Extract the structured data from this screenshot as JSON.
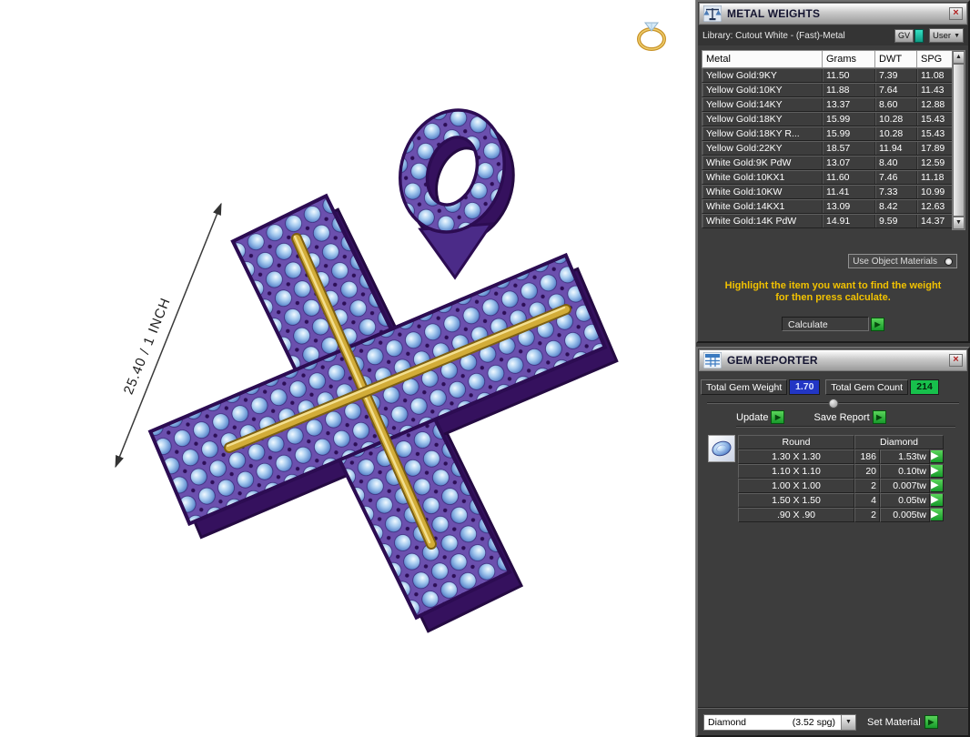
{
  "icons": {
    "close": "×",
    "dropdown": "▼",
    "scroll_up": "▲",
    "scroll_down": "▼",
    "play": "▶"
  },
  "viewport": {
    "dimension_label": "25.40 / 1 INCH"
  },
  "metal_weights": {
    "title": "METAL WEIGHTS",
    "library": "Library: Cutout White - (Fast)-Metal",
    "gv_label": "GV",
    "user_label": "User",
    "columns": [
      "Metal",
      "Grams",
      "DWT",
      "SPG"
    ],
    "rows": [
      {
        "metal": "Yellow Gold:9KY",
        "grams": "11.50",
        "dwt": "7.39",
        "spg": "11.08"
      },
      {
        "metal": "Yellow Gold:10KY",
        "grams": "11.88",
        "dwt": "7.64",
        "spg": "11.43"
      },
      {
        "metal": "Yellow Gold:14KY",
        "grams": "13.37",
        "dwt": "8.60",
        "spg": "12.88"
      },
      {
        "metal": "Yellow Gold:18KY",
        "grams": "15.99",
        "dwt": "10.28",
        "spg": "15.43"
      },
      {
        "metal": "Yellow Gold:18KY R...",
        "grams": "15.99",
        "dwt": "10.28",
        "spg": "15.43"
      },
      {
        "metal": "Yellow Gold:22KY",
        "grams": "18.57",
        "dwt": "11.94",
        "spg": "17.89"
      },
      {
        "metal": "White Gold:9K PdW",
        "grams": "13.07",
        "dwt": "8.40",
        "spg": "12.59"
      },
      {
        "metal": "White Gold:10KX1",
        "grams": "11.60",
        "dwt": "7.46",
        "spg": "11.18"
      },
      {
        "metal": "White Gold:10KW",
        "grams": "11.41",
        "dwt": "7.33",
        "spg": "10.99"
      },
      {
        "metal": "White Gold:14KX1",
        "grams": "13.09",
        "dwt": "8.42",
        "spg": "12.63"
      },
      {
        "metal": "White Gold:14K PdW",
        "grams": "14.91",
        "dwt": "9.59",
        "spg": "14.37"
      }
    ],
    "use_object_materials": "Use Object Materials",
    "instruction_line1": "Highlight the item you want to find the weight",
    "instruction_line2": "for then press calculate.",
    "calculate_label": "Calculate"
  },
  "gem_reporter": {
    "title": "GEM REPORTER",
    "total_weight_label": "Total Gem Weight",
    "total_weight_value": "1.70",
    "total_count_label": "Total Gem Count",
    "total_count_value": "214",
    "update_label": "Update",
    "save_report_label": "Save Report",
    "shape_header": "Round",
    "material_header": "Diamond",
    "rows": [
      {
        "size": "1.30 X 1.30",
        "count": "186",
        "weight": "1.53tw"
      },
      {
        "size": "1.10 X 1.10",
        "count": "20",
        "weight": "0.10tw"
      },
      {
        "size": "1.00 X 1.00",
        "count": "2",
        "weight": "0.007tw"
      },
      {
        "size": "1.50 X 1.50",
        "count": "4",
        "weight": "0.05tw"
      },
      {
        "size": ".90 X .90",
        "count": "2",
        "weight": "0.005tw"
      }
    ],
    "material_name": "Diamond",
    "material_spg": "(3.52 spg)",
    "set_material_label": "Set Material"
  }
}
